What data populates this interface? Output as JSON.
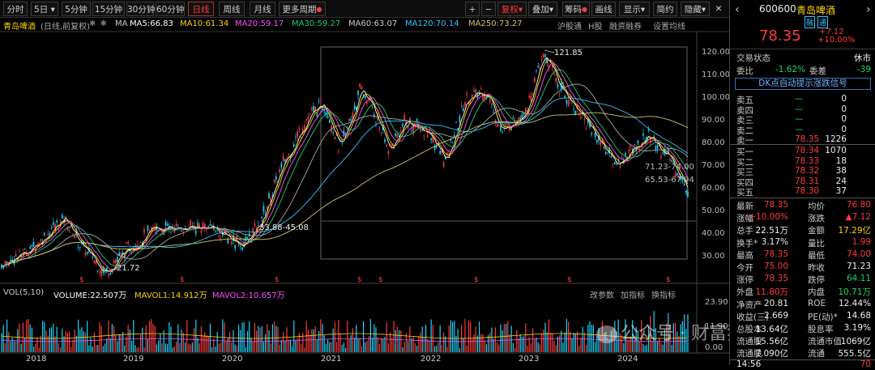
{
  "toolbar": {
    "left": [
      "分时",
      "5日",
      "5分钟",
      "15分钟",
      "30分钟",
      "60分钟",
      "日线",
      "周线",
      "月线",
      "更多周期"
    ],
    "right": [
      "复权",
      "叠加",
      "筹码",
      "画线",
      "显示",
      "简约",
      "隐藏"
    ]
  },
  "info": {
    "name": "青岛啤酒",
    "mode": "(日线,前复权)",
    "ma": "MA",
    "ma5": "MA5:66.83",
    "ma10": "MA10:61.34",
    "ma20": "MA20:59.17",
    "ma30": "MA30:59.27",
    "ma60": "MA60:63.07",
    "ma120": "MA120:70.14",
    "ma250": "MA250:73.27",
    "links": [
      "沪股通",
      "H股",
      "融资融券",
      "设置均线"
    ]
  },
  "chart": {
    "yticks": [
      "120.00",
      "110.00",
      "100.00",
      "90.00",
      "80.00",
      "70.00",
      "60.00",
      "50.00",
      "40.00",
      "30.00"
    ],
    "high_label": "121.85",
    "low_label": "21.72",
    "range_label": "33.88-45.08",
    "zone_label1": "71.23-74.00",
    "zone_label2": "65.53-67.94",
    "vol_info": {
      "vol": "VOL(5,10)",
      "volume": "VOLUME:22.507万",
      "mavol1": "MAVOL1:14.912万",
      "mavol2": "MAVOL2:10.657万"
    },
    "vol_links": [
      "改参数",
      "加指标",
      "换指标"
    ],
    "vol_yticks": [
      "23.90",
      "11.90",
      "0.00"
    ],
    "years": [
      "2018",
      "2019",
      "2020",
      "2021",
      "2022",
      "2023",
      "2024"
    ],
    "watermark": "公众号 · 财富猎角兽",
    "colors": {
      "up": "#ff3b3b",
      "down": "#1ad5ff",
      "ma5": "#ffffff",
      "ma10": "#ffd400",
      "ma20": "#ff4dff",
      "ma30": "#19d36b",
      "ma60": "#aaaaaa",
      "ma120": "#2ec7ff",
      "ma250": "#d4c26a"
    }
  },
  "right": {
    "code": "600600",
    "name": "青岛啤酒",
    "tags": [
      "融",
      "通"
    ],
    "price": "78.35",
    "change": "+7.12",
    "pct": "+10.00%",
    "trade_state_lbl": "交易状态",
    "trade_state": "休市",
    "weibi_lbl": "委比",
    "weibi": "-1.62%",
    "weicha_lbl": "委差",
    "weicha": "-39",
    "dk": "DK点自动提示涨跌信号",
    "sells": [
      {
        "label": "卖五",
        "price": "—",
        "vol": "0"
      },
      {
        "label": "卖四",
        "price": "—",
        "vol": "0"
      },
      {
        "label": "卖三",
        "price": "—",
        "vol": "0"
      },
      {
        "label": "卖二",
        "price": "—",
        "vol": "0"
      },
      {
        "label": "卖一",
        "price": "78.35",
        "vol": "1226"
      }
    ],
    "buys": [
      {
        "label": "买一",
        "price": "78.34",
        "vol": "1070"
      },
      {
        "label": "买二",
        "price": "78.33",
        "vol": "18"
      },
      {
        "label": "买三",
        "price": "78.32",
        "vol": "38"
      },
      {
        "label": "买四",
        "price": "78.31",
        "vol": "24"
      },
      {
        "label": "买五",
        "price": "78.30",
        "vol": "37"
      }
    ],
    "stats": [
      [
        "最新",
        "78.35",
        "red",
        "均价",
        "76.80",
        "red"
      ],
      [
        "涨幅",
        "+10.00%",
        "red",
        "涨跌",
        "▲7.12",
        "red"
      ],
      [
        "总手",
        "22.51万",
        "wht",
        "金额",
        "17.29亿",
        "yel"
      ],
      [
        "换手*",
        "3.17%",
        "wht",
        "量比",
        "1.99",
        "red"
      ],
      [
        "最高",
        "78.35",
        "red",
        "最低",
        "74.00",
        "red"
      ],
      [
        "今开",
        "75.00",
        "red",
        "昨收",
        "71.23",
        "wht"
      ],
      [
        "涨停",
        "78.35",
        "red",
        "跌停",
        "64.11",
        "grn"
      ],
      [
        "外盘",
        "11.80万",
        "red",
        "内盘",
        "10.71万",
        "grn"
      ],
      [
        "净资产",
        "20.81",
        "wht",
        "ROE",
        "12.44%",
        "wht"
      ],
      [
        "收益(三)",
        "2.669",
        "wht",
        "PE(动)*",
        "14.68",
        "wht"
      ],
      [
        "总股本",
        "13.64亿",
        "wht",
        "股息率",
        "3.19%",
        "wht"
      ],
      [
        "流通股",
        "15.56亿",
        "wht",
        "流通市值",
        "1069亿",
        "wht"
      ],
      [
        "流通股",
        "7.090亿",
        "wht",
        "流通",
        "555.5亿",
        "wht"
      ]
    ],
    "bottom": "14:56",
    "bottom_r": "70"
  }
}
